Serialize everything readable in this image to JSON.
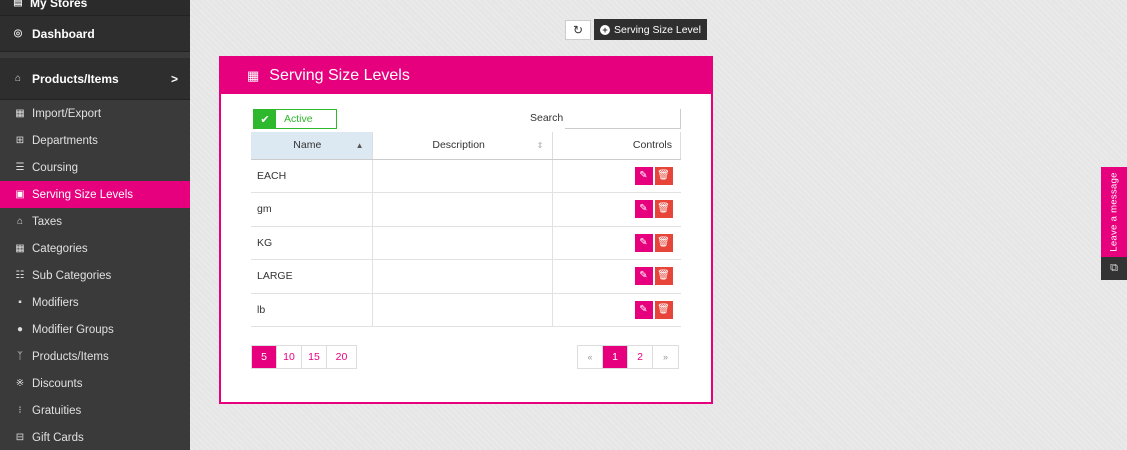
{
  "sidebar": {
    "top_label": "My Stores",
    "dashboard": "Dashboard",
    "products_header": "Products/Items",
    "chevron": ">",
    "items": [
      {
        "label": "Import/Export",
        "icon": "import-icon"
      },
      {
        "label": "Departments",
        "icon": "departments-icon"
      },
      {
        "label": "Coursing",
        "icon": "coursing-icon"
      },
      {
        "label": "Serving Size Levels",
        "icon": "serving-size-icon"
      },
      {
        "label": "Taxes",
        "icon": "taxes-icon"
      },
      {
        "label": "Categories",
        "icon": "categories-icon"
      },
      {
        "label": "Sub Categories",
        "icon": "subcategories-icon"
      },
      {
        "label": "Modifiers",
        "icon": "modifiers-icon"
      },
      {
        "label": "Modifier Groups",
        "icon": "modifier-groups-icon"
      },
      {
        "label": "Products/Items",
        "icon": "products-icon"
      },
      {
        "label": "Discounts",
        "icon": "discounts-icon"
      },
      {
        "label": "Gratuities",
        "icon": "gratuities-icon"
      },
      {
        "label": "Gift Cards",
        "icon": "gift-cards-icon"
      }
    ],
    "active_item": "Serving Size Levels"
  },
  "actions": {
    "add_button": "Serving Size Level"
  },
  "panel": {
    "title": "Serving Size Levels",
    "active_toggle": "Active",
    "search_label": "Search",
    "search_value": "",
    "columns": [
      "Name",
      "Description",
      "Controls"
    ],
    "rows": [
      {
        "name": "EACH",
        "description": ""
      },
      {
        "name": "gm",
        "description": ""
      },
      {
        "name": "KG",
        "description": ""
      },
      {
        "name": "LARGE",
        "description": ""
      },
      {
        "name": "lb",
        "description": ""
      }
    ],
    "page_sizes": [
      "5",
      "10",
      "15",
      "20"
    ],
    "selected_page_size": "5",
    "pager": {
      "prev": "«",
      "pages": [
        "1",
        "2"
      ],
      "current": "1",
      "next": "»"
    }
  },
  "leave_message": "Leave a message",
  "colors": {
    "accent": "#e6007e",
    "active_green": "#2db82d",
    "delete_red": "#e8453a",
    "sidebar_bg": "#3a3a3a"
  }
}
